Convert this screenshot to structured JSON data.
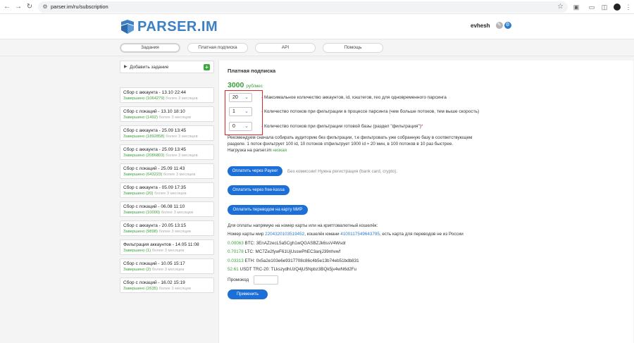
{
  "browser": {
    "url": "parser.im/ru/subscription"
  },
  "header": {
    "logo_text": "PARSER.IM",
    "username": "evhesh"
  },
  "tabs": [
    {
      "label": "Задания"
    },
    {
      "label": "Платная подписка"
    },
    {
      "label": "API"
    },
    {
      "label": "Помощь"
    }
  ],
  "sidebar": {
    "add_task_label": "Добавить задание",
    "tasks": [
      {
        "title": "Сбор с аккаунта - 13.10 22:44",
        "status": "Завершено",
        "count": "(1064279)",
        "age": "более 3 месяцев"
      },
      {
        "title": "Сбор с локаций - 13.10 18:10",
        "status": "Завершено",
        "count": "(1492)",
        "age": "более 3 месяцев"
      },
      {
        "title": "Сбор с аккаунта - 25.09 13:45",
        "status": "Завершено",
        "count": "(1892858)",
        "age": "более 3 месяцев"
      },
      {
        "title": "Сбор с аккаунта - 25.09 13:45",
        "status": "Завершено",
        "count": "(2086803)",
        "age": "более 3 месяцев"
      },
      {
        "title": "Сбор с локаций - 25.09 11:43",
        "status": "Завершено",
        "count": "(643223)",
        "age": "более 3 месяцев"
      },
      {
        "title": "Сбор с аккаунта - 05.09 17:35",
        "status": "Завершено",
        "count": "(20)",
        "age": "более 3 месяцев"
      },
      {
        "title": "Сбор с локаций - 06.08 11:10",
        "status": "Завершено",
        "count": "(10000)",
        "age": "более 3 месяцев"
      },
      {
        "title": "Сбор с аккаунта - 20.05 13:15",
        "status": "Завершено",
        "count": "(9898)",
        "age": "более 3 месяцев"
      },
      {
        "title": "Фильтрация аккаунтов - 14.05 11:08",
        "status": "Завершено",
        "count": "(1)",
        "age": "более 3 месяцев"
      },
      {
        "title": "Сбор с локаций - 10.05 15:17",
        "status": "Завершено",
        "count": "(2)",
        "age": "более 3 месяцев"
      },
      {
        "title": "Сбор с локаций - 16.02 15:19",
        "status": "Завершено",
        "count": "(2635)",
        "age": "более 3 месяцев"
      }
    ]
  },
  "main": {
    "section_title": "Платная подписка",
    "price": "3000",
    "price_unit": "руб/мес",
    "options": [
      {
        "value": "20",
        "label": "- Максимальное количество аккаунтов, id, хэштегов, гео для одновременного парсинга"
      },
      {
        "value": "1",
        "label": "- Количество потоков при фильтрации в процессе парсинга (чем больше потоков, тем выше скорость)"
      },
      {
        "value": "0",
        "label": "- Количество потоков при фильтрации готовой базы (раздел \"фильтрация\")"
      }
    ],
    "required_mark": "*",
    "recommendation_line1": "Рекомендуем сначала собирать аудиторию без фильтрации, т.е фильтровать уже собранную базу в соответствующем",
    "recommendation_line2": "разделе. 1 поток фильтрует 100 id, 10 потоков отфильтрует 1000 id ≈ 20 мин, в 100 потоков в 10 раз быстрее.",
    "load_label": "Нагрузка на parser.im",
    "load_value": "низкая",
    "btn_payeer": "Оплатить через Payeer",
    "payeer_note": "Без комиссии! Нужна регистрация (bank card, crypto).",
    "btn_freekassa": "Оплатить через free-kassa",
    "btn_mir": "Оплатить переводом на карту МИР",
    "direct_pay_title": "Для оплаты напрямую на номер карты или на криптовалютный кошелёк:",
    "card_prefix": "Номер карты мир",
    "card_number": "2204320103519452",
    "wallet_prefix": ", кошелёк юмани",
    "wallet_number": "4100117549643795",
    "card_suffix": ", есть карта для переводов не из России",
    "crypto": [
      {
        "amount": "0.00063",
        "rest": "BTC: 3EnAZzecL5a5Cgh1wQGASBZJk6ssV4Wsdr"
      },
      {
        "amount": "0.70178",
        "rest": "LTC: MC7Ze2fywF61UjUsswPhEC3anjJ39nhvwf"
      },
      {
        "amount": "0.03313",
        "rest": "ETH: 0x5a2e103e6e9317708c86c4b5e13b74eb51bdb831"
      },
      {
        "amount": "52.61",
        "rest": "USDT TRC-20: TLkszydhUzQ4jU5Npbz3BQk5jv4wN6d2Fu"
      }
    ],
    "promo_label": "Промокод",
    "promo_value": "",
    "apply_label": "Применить"
  },
  "colors": {
    "brand_blue": "#3b7fc4",
    "button_blue": "#1d6fd8",
    "success_green": "#3aa03a",
    "highlight_red": "#e0262b"
  }
}
